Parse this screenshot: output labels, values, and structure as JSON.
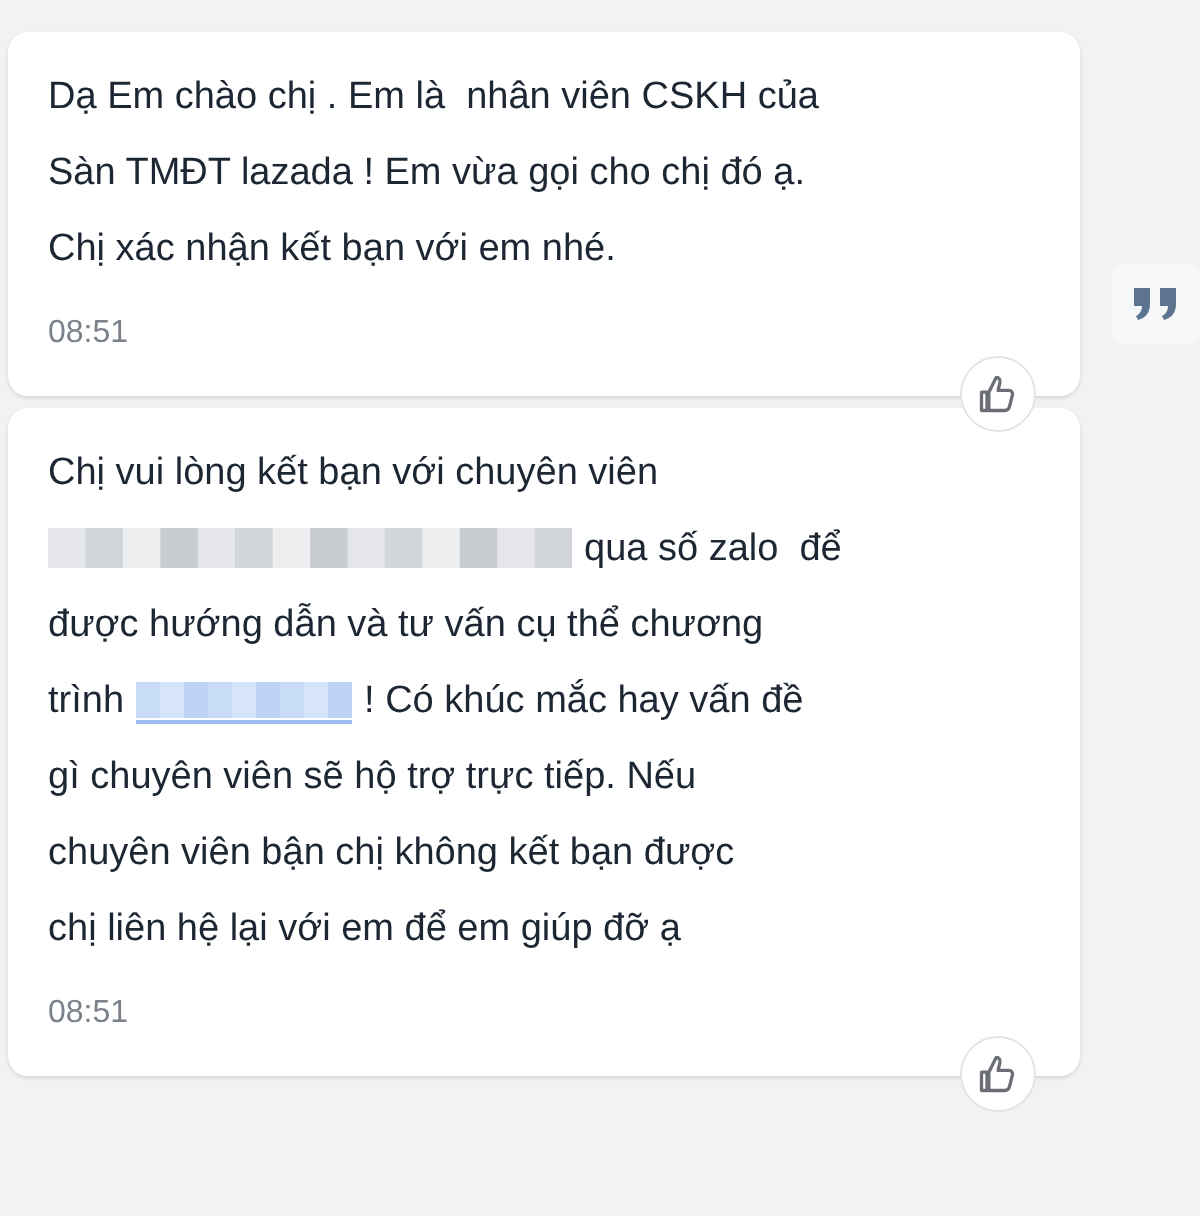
{
  "messages": [
    {
      "lines": [
        [
          {
            "kind": "text",
            "text": "Dạ Em chào chị . Em là  nhân viên CSKH của"
          }
        ],
        [
          {
            "kind": "text",
            "text": "Sàn TMĐT lazada ! Em vừa gọi cho chị đó ạ."
          }
        ],
        [
          {
            "kind": "text",
            "text": "Chị xác nhận kết bạn với em nhé."
          }
        ]
      ],
      "time": "08:51",
      "quote_button": true
    },
    {
      "lines": [
        [
          {
            "kind": "text",
            "text": "Chị vui lòng kết bạn với chuyên viên"
          }
        ],
        [
          {
            "kind": "redacted"
          },
          {
            "kind": "text",
            "text": "qua số zalo  để"
          }
        ],
        [
          {
            "kind": "text",
            "text": "được hướng dẫn và tư vấn cụ thể chương"
          }
        ],
        [
          {
            "kind": "text",
            "text": "trình"
          },
          {
            "kind": "redacted-link"
          },
          {
            "kind": "text",
            "text": "! Có khúc mắc hay vấn đề"
          }
        ],
        [
          {
            "kind": "text",
            "text": "gì chuyên viên sẽ hộ trợ trực tiếp. Nếu"
          }
        ],
        [
          {
            "kind": "text",
            "text": "chuyên viên bận chị không kết bạn được"
          }
        ],
        [
          {
            "kind": "text",
            "text": "chị liên hệ lại với em để em giúp đỡ ạ"
          }
        ]
      ],
      "time": "08:51",
      "quote_button": false
    }
  ]
}
